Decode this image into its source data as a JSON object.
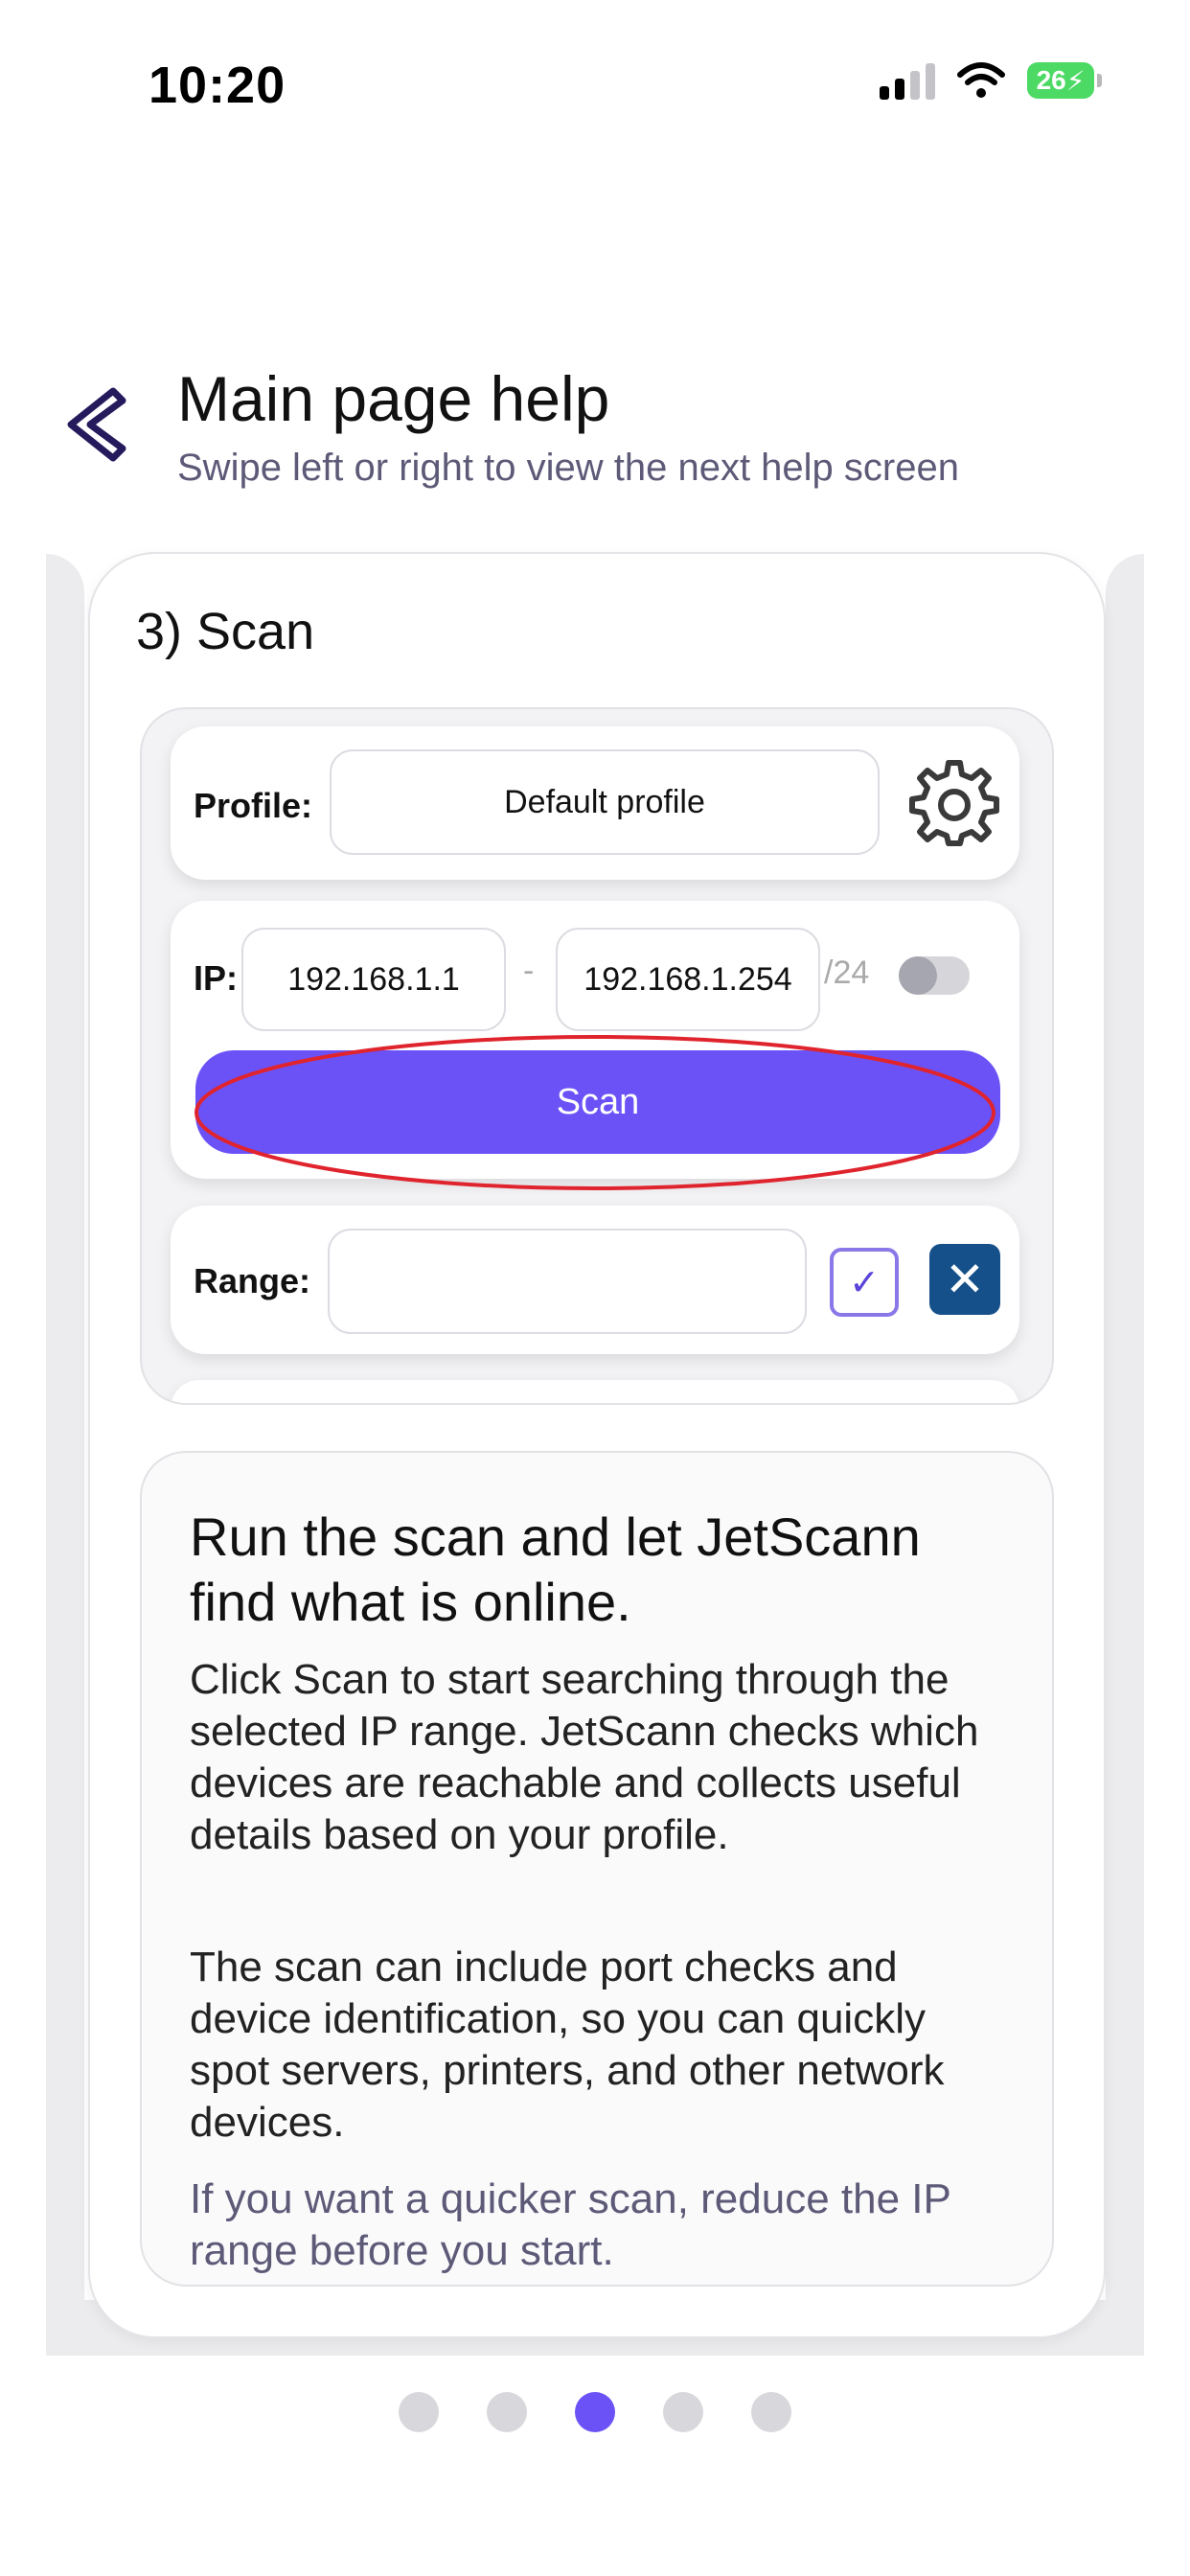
{
  "status_bar": {
    "time": "10:20",
    "battery": "26"
  },
  "header": {
    "title": "Main page help",
    "subtitle": "Swipe left or right to view the next help screen"
  },
  "card": {
    "title": "3) Scan",
    "preview": {
      "profile_label": "Profile:",
      "profile_value": "Default profile",
      "ip_label": "IP:",
      "ip_start": "192.168.1.1",
      "separator": "-",
      "ip_end": "192.168.1.254",
      "cidr": "/24",
      "scan_label": "Scan",
      "range_label": "Range:",
      "range_value": ""
    },
    "description": {
      "heading": "Run the scan and let JetScann find what is online.",
      "paragraphs": [
        "Click Scan to start searching through the selected IP range. JetScann checks which devices are reachable and collects useful details based on your profile.",
        "The scan can include port checks and device identification, so you can quickly spot servers, printers, and other network devices.",
        "If you want a quicker scan, reduce the IP range before you start."
      ]
    }
  },
  "pagination": {
    "total": 5,
    "active_index": 2
  },
  "colors": {
    "accent": "#6a52f7",
    "highlight": "#e0242e",
    "cancel": "#15508a"
  }
}
